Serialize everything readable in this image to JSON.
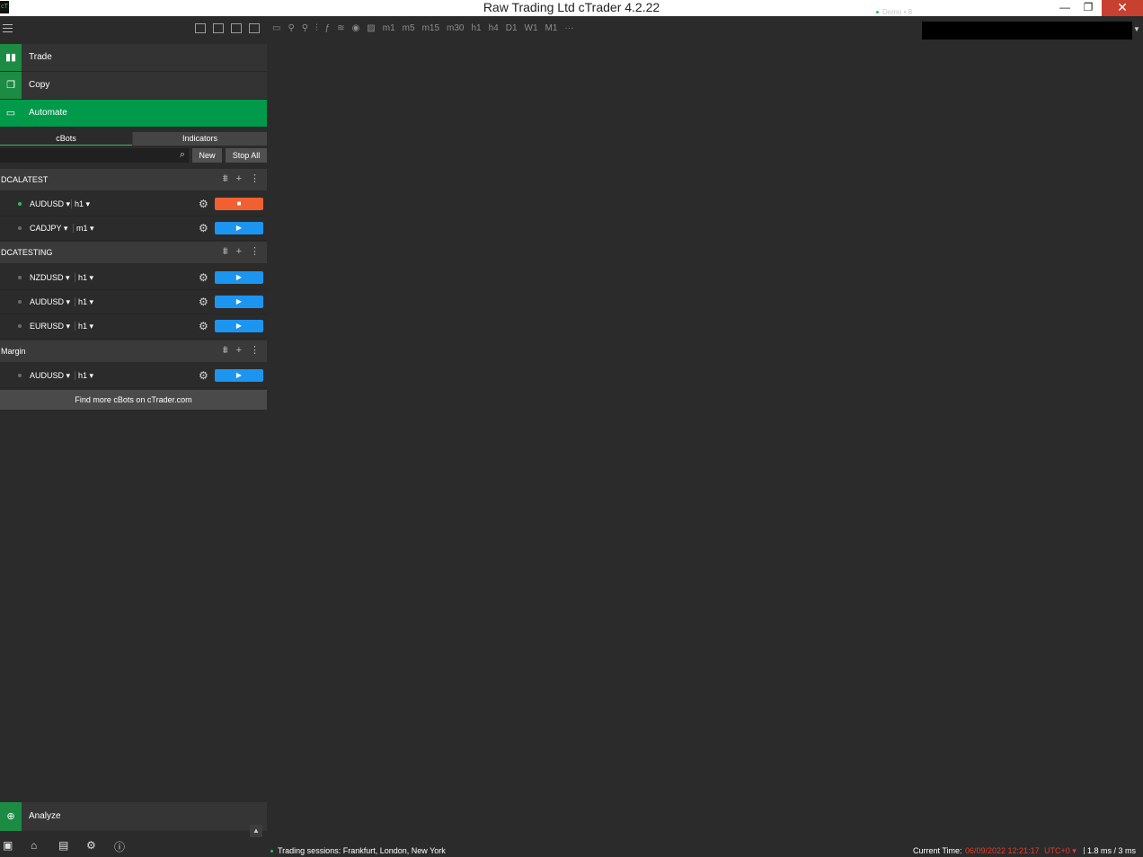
{
  "window": {
    "title": "Raw Trading Ltd cTrader 4.2.22",
    "app_icon_text": "cT",
    "min_glyph": "—",
    "max_glyph": "❐",
    "close_glyph": "✕"
  },
  "nav": {
    "trade": "Trade",
    "copy": "Copy",
    "automate": "Automate",
    "analyze": "Analyze"
  },
  "tabs": {
    "cbots": "cBots",
    "indicators": "Indicators"
  },
  "actions": {
    "new": "New",
    "stop_all": "Stop All"
  },
  "groups": [
    {
      "name": "DCALATEST",
      "instances": [
        {
          "symbol": "AUDUSD",
          "timeframe": "h1",
          "running": true
        },
        {
          "symbol": "CADJPY",
          "timeframe": "m1",
          "running": false
        }
      ]
    },
    {
      "name": "DCATESTING",
      "instances": [
        {
          "symbol": "NZDUSD",
          "timeframe": "h1",
          "running": false
        },
        {
          "symbol": "AUDUSD",
          "timeframe": "h1",
          "running": false
        },
        {
          "symbol": "EURUSD",
          "timeframe": "h1",
          "running": false
        }
      ]
    },
    {
      "name": "Margin",
      "instances": [
        {
          "symbol": "AUDUSD",
          "timeframe": "h1",
          "running": false
        }
      ]
    }
  ],
  "find_more": "Find more cBots on cTrader.com",
  "account": {
    "label": "Demo • 8",
    "status_color": "#2fbf5a"
  },
  "toolbar_timeframes": [
    "m1",
    "m5",
    "m15",
    "m30",
    "h1",
    "h4",
    "D1",
    "W1",
    "M1"
  ],
  "status": {
    "sessions": "Trading sessions: Frankfurt, London, New York",
    "current_time_label": "Current Time:",
    "current_time": "06/09/2022 12:21:17",
    "tz": "UTC+0",
    "latency": "1.8 ms / 3 ms"
  },
  "colors": {
    "accent_green": "#009a4a",
    "play_blue": "#1b95f0",
    "stop_orange": "#f06030",
    "time_red": "#e23e2b"
  }
}
